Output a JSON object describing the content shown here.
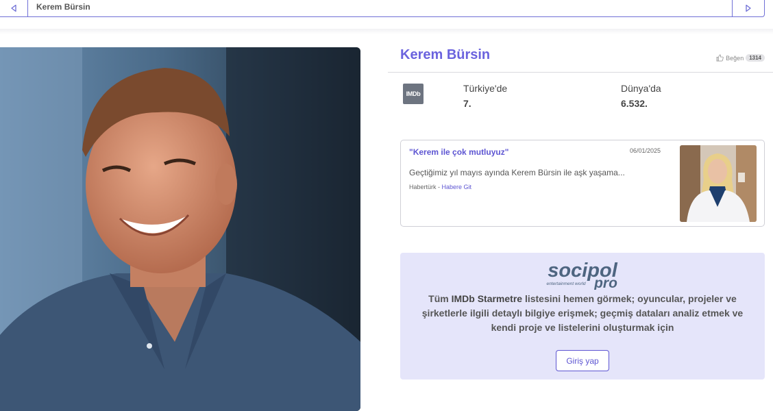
{
  "topbar": {
    "title": "Kerem Bürsin"
  },
  "profile": {
    "name": "Kerem Bürsin",
    "like_label": "Beğen",
    "like_count": "1314"
  },
  "ranking": {
    "source_logo": "IMDb",
    "turkey_label": "Türkiye'de",
    "turkey_value": "7.",
    "world_label": "Dünya'da",
    "world_value": "6.532."
  },
  "news": {
    "title": "\"Kerem ile çok mutluyuz\"",
    "date": "06/01/2025",
    "snippet": "Geçtiğimiz yıl mayıs ayında Kerem Bürsin ile aşk yaşama...",
    "source": "Habertürk",
    "separator": " - ",
    "link_label": "Habere Git"
  },
  "promo": {
    "logo_main": "socipol",
    "logo_tagline": "entertainment world",
    "logo_pro": "pro",
    "text_prefix": "Tüm ",
    "text_bold": "IMDb Starmetre",
    "text_suffix": " listesini hemen görmek; oyuncular, projeler ve şirketlerle ilgili detaylı bilgiye erişmek; geçmiş dataları analiz etmek ve kendi proje ve listelerini oluşturmak için",
    "login_label": "Giriş yap"
  },
  "icons": {
    "prev": "chevron-left-icon",
    "next": "chevron-right-icon",
    "like": "thumbs-up-icon"
  },
  "colors": {
    "accent": "#6b63de",
    "promo_bg": "#e5e5fa",
    "imdb_logo_bg": "#6d7480"
  }
}
